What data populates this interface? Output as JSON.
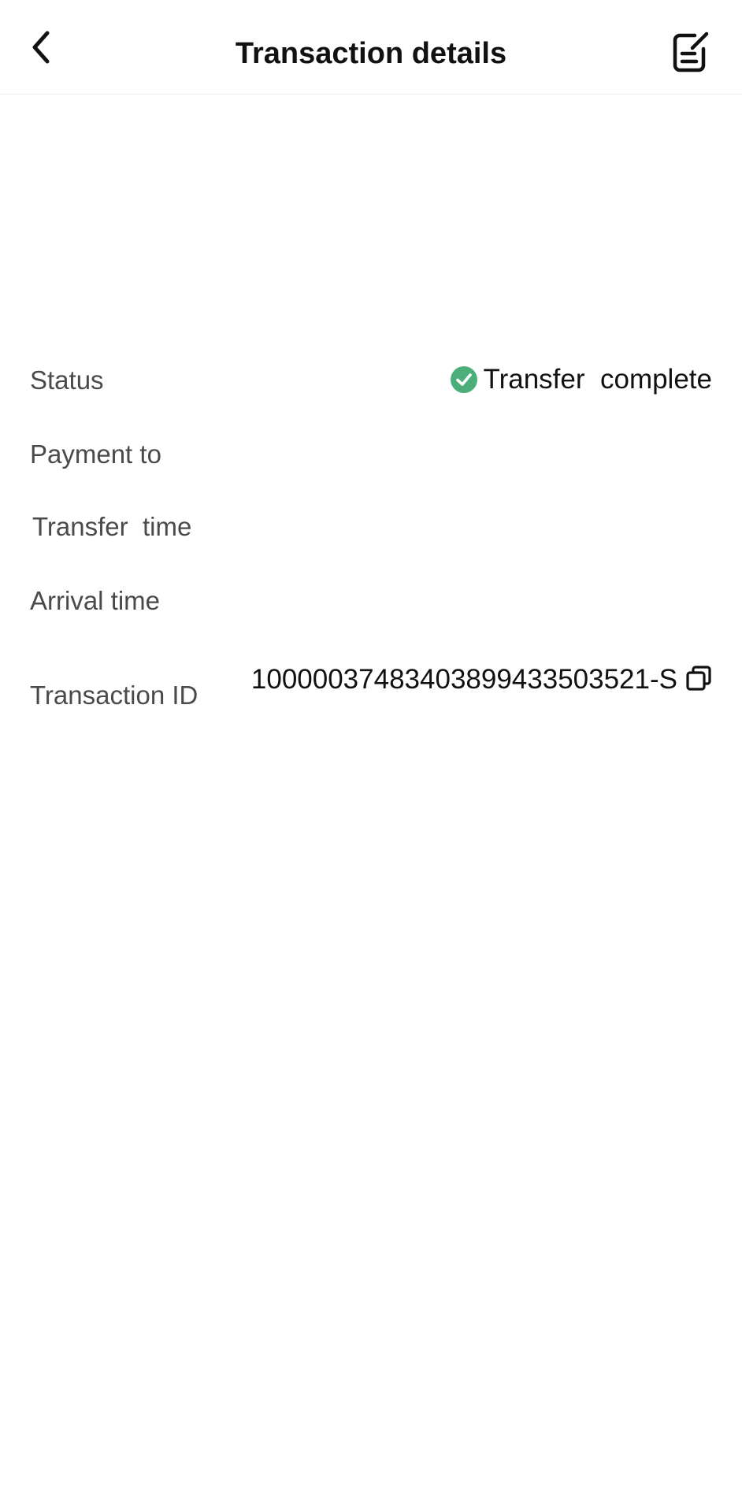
{
  "header": {
    "title": "Transaction details",
    "back_icon": "chevron-left-icon",
    "notes_icon": "note-edit-icon"
  },
  "details": {
    "status": {
      "label": "Status",
      "value": "Transfer  complete",
      "icon": "check-circle-icon",
      "icon_color": "#4caf7a"
    },
    "payment_to": {
      "label": "Payment to",
      "value": ""
    },
    "transfer_time": {
      "label": "Transfer  time",
      "value": ""
    },
    "arrival_time": {
      "label": "Arrival time",
      "value": ""
    },
    "transaction_id": {
      "label": "Transaction ID",
      "value": "10000037483403899433503521-S",
      "copy_icon": "copy-icon"
    }
  }
}
